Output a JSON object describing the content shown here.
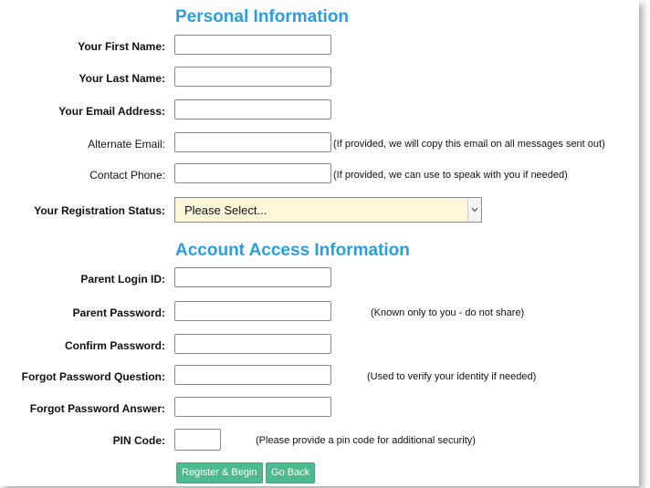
{
  "personal": {
    "title": "Personal Information",
    "first_name": {
      "label": "Your First Name:",
      "value": ""
    },
    "last_name": {
      "label": "Your Last Name:",
      "value": ""
    },
    "email": {
      "label": "Your Email Address:",
      "value": ""
    },
    "alt_email": {
      "label": "Alternate Email:",
      "value": "",
      "note": "(If provided, we will copy this email on all messages sent out)"
    },
    "phone": {
      "label": "Contact Phone:",
      "value": "",
      "note": "(If provided, we can use to speak with you if needed)"
    },
    "status": {
      "label": "Your Registration Status:",
      "selected": "Please Select..."
    }
  },
  "account": {
    "title": "Account Access Information",
    "login_id": {
      "label": "Parent Login ID:",
      "value": ""
    },
    "password": {
      "label": "Parent Password:",
      "value": "",
      "note": "(Known only to you - do not share)"
    },
    "confirm": {
      "label": "Confirm Password:",
      "value": ""
    },
    "question": {
      "label": "Forgot Password Question:",
      "value": "",
      "note": "(Used to verify your identity if needed)"
    },
    "answer": {
      "label": "Forgot Password Answer:",
      "value": ""
    },
    "pin": {
      "label": "PIN Code:",
      "value": "",
      "note": "(Please provide a pin code for additional security)"
    }
  },
  "buttons": {
    "register": "Register & Begin",
    "back": "Go Back"
  },
  "colors": {
    "heading": "#2a9fe0",
    "button": "#4dbb8f",
    "select_bg": "#fdf6d9"
  }
}
